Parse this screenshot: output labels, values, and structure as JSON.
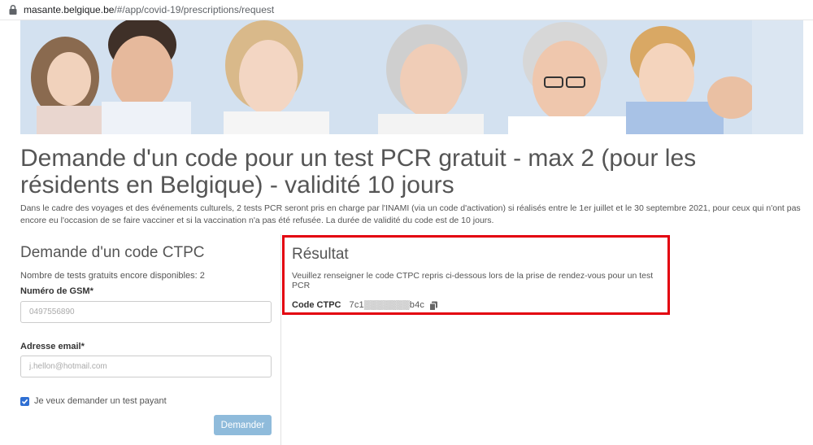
{
  "browser": {
    "url_host": "masante.belgique.be",
    "url_path": "/#/app/covid-19/prescriptions/request"
  },
  "page": {
    "title": "Demande d'un code pour un test PCR gratuit - max 2 (pour les résidents en Belgique) - validité 10 jours",
    "intro": "Dans le cadre des voyages et des événements culturels, 2 tests PCR seront pris en charge par l'INAMI (via un code d'activation) si réalisés entre le 1er juillet et le 30 septembre 2021, pour ceux qui n'ont pas encore eu l'occasion de se faire vacciner et si la vaccination n'a pas été refusée. La durée de validité du code est de 10 jours."
  },
  "form": {
    "title": "Demande d'un code CTPC",
    "remaining": "Nombre de tests gratuits encore disponibles: 2",
    "gsm_label": "Numéro de GSM*",
    "gsm_value": "0497556890",
    "email_label": "Adresse email*",
    "email_value": "j.hellon@hotmail.com",
    "checkbox_checked": true,
    "checkbox_label": "Je veux demander un test payant",
    "submit_label": "Demander"
  },
  "result": {
    "title": "Résultat",
    "description": "Veuillez renseigner le code CTPC repris ci-dessous lors de la prise de rendez-vous pour un test PCR",
    "code_label": "Code CTPC",
    "code_value": "7c1▒▒▒▒▒▒▒b4c",
    "highlight_color": "#e3000f"
  },
  "icons": {
    "lock": "lock-icon",
    "copy": "copy-icon",
    "check": "check-icon"
  },
  "colors": {
    "button": "#8fbbdb",
    "checkbox": "#2f6fd3",
    "text": "#555555"
  }
}
